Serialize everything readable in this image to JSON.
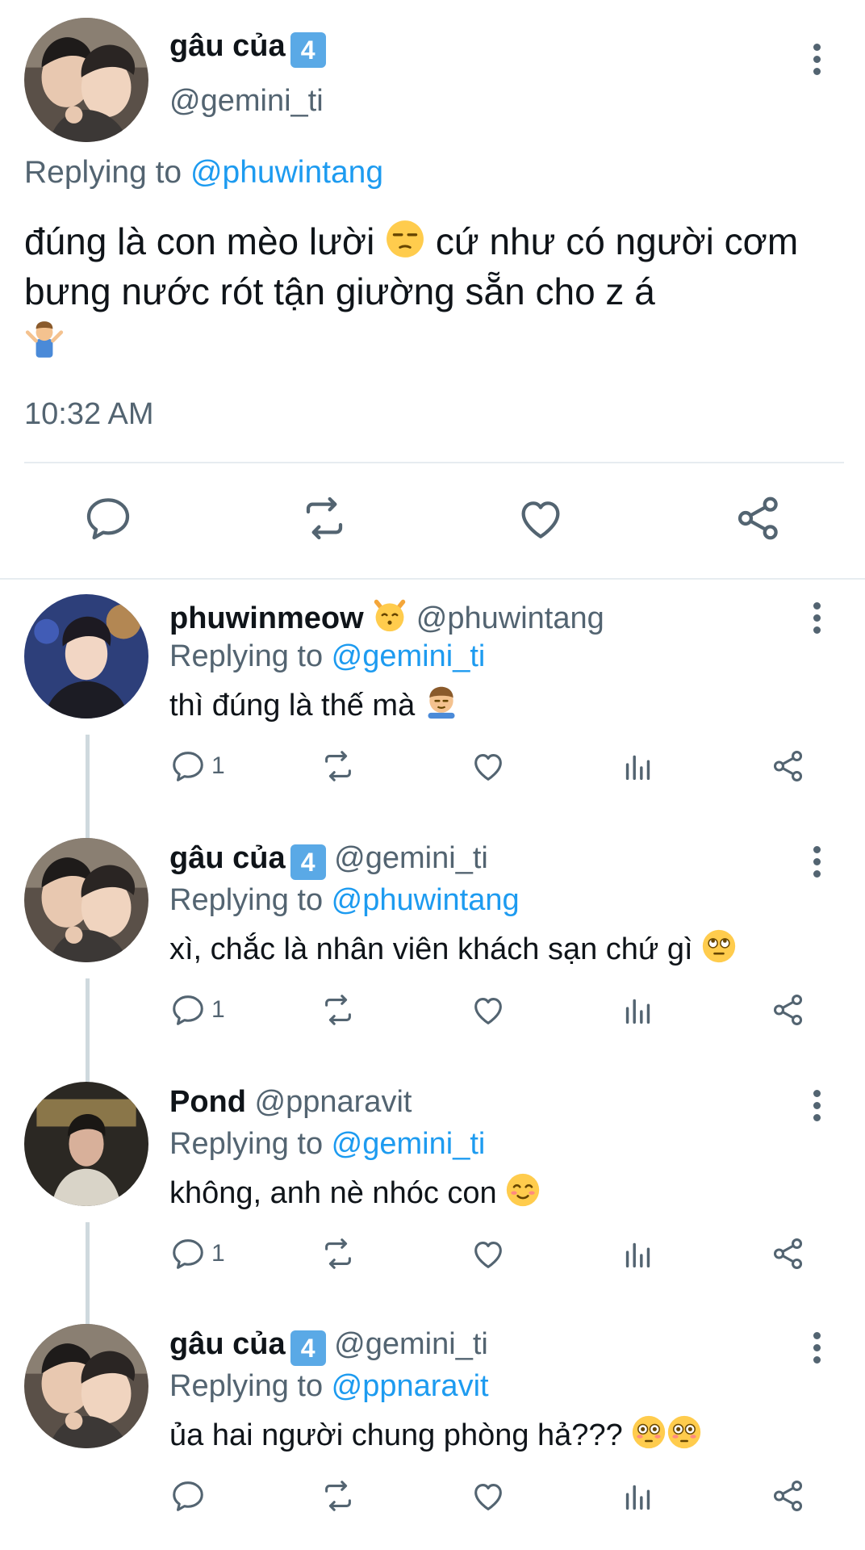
{
  "main_tweet": {
    "name": "gâu của",
    "badge": "4",
    "handle": "@gemini_ti",
    "replying_prefix": "Replying to ",
    "replying_to": "@phuwintang",
    "text_part1": "đúng là con mèo lười",
    "text_part2": " cứ như có người cơm bưng nước rót tận giường sẵn cho z á",
    "time": "10:32 AM"
  },
  "replies": [
    {
      "name": "phuwinmeow",
      "handle": "@phuwintang",
      "replying_prefix": "Replying to ",
      "replying_to": "@gemini_ti",
      "text": "thì đúng là thế mà",
      "reply_count": "1"
    },
    {
      "name": "gâu của",
      "badge": "4",
      "handle": "@gemini_ti",
      "replying_prefix": "Replying to ",
      "replying_to": "@phuwintang",
      "text": "xì, chắc là nhân viên khách sạn chứ gì",
      "reply_count": "1"
    },
    {
      "name": "Pond",
      "handle": "@ppnaravit",
      "replying_prefix": "Replying to ",
      "replying_to": "@gemini_ti",
      "text": "không, anh nè nhóc con",
      "reply_count": "1"
    },
    {
      "name": "gâu của",
      "badge": "4",
      "handle": "@gemini_ti",
      "replying_prefix": "Replying to ",
      "replying_to": "@ppnaravit",
      "text": "ủa hai người chung phòng hả???",
      "reply_count": ""
    }
  ],
  "icons": {
    "reply": "reply-icon",
    "retweet": "retweet-icon",
    "like": "heart-icon",
    "stats": "stats-icon",
    "share": "share-icon",
    "more": "more-icon"
  },
  "colors": {
    "text": "#0f1419",
    "secondary": "#536471",
    "link": "#1d9bf0",
    "divider": "#e6ecf0"
  }
}
